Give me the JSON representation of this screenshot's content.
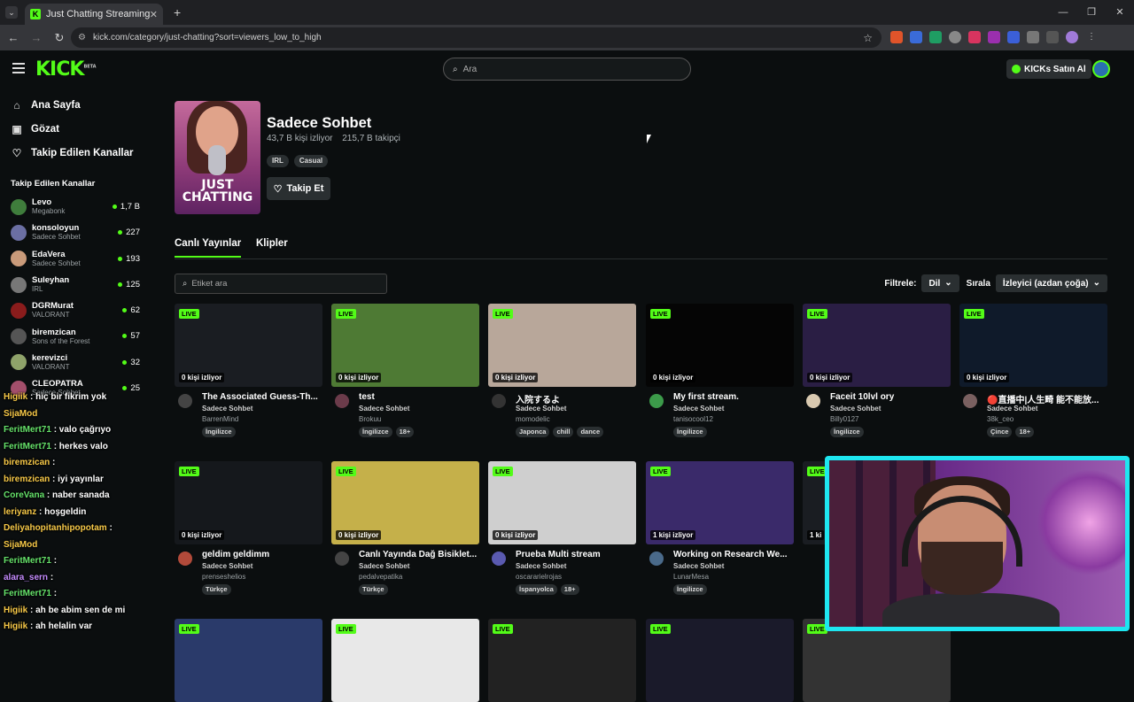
{
  "browser": {
    "tab_title": "Just Chatting Streaming - Live S",
    "url": "kick.com/category/just-chatting?sort=viewers_low_to_high"
  },
  "header": {
    "logo": "KICK",
    "logo_badge": "BETA",
    "search_placeholder": "Ara",
    "kicks_button": "KICKs Satın Al"
  },
  "sidebar": {
    "nav": [
      {
        "label": "Ana Sayfa",
        "icon": "home-icon"
      },
      {
        "label": "Gözat",
        "icon": "browse-icon"
      },
      {
        "label": "Takip Edilen Kanallar",
        "icon": "heart-icon"
      }
    ],
    "section_title": "Takip Edilen Kanallar",
    "channels": [
      {
        "name": "Levo",
        "category": "Megabonk",
        "viewers": "1,7 B",
        "color": "#3f7d3c"
      },
      {
        "name": "konsoloyun",
        "category": "Sadece Sohbet",
        "viewers": "227",
        "color": "#6b6fa3"
      },
      {
        "name": "EdaVera",
        "category": "Sadece Sohbet",
        "viewers": "193",
        "color": "#c99a7a"
      },
      {
        "name": "Suleyhan",
        "category": "IRL",
        "viewers": "125",
        "color": "#777"
      },
      {
        "name": "DGRMurat",
        "category": "VALORANT",
        "viewers": "62",
        "color": "#8a1c1c"
      },
      {
        "name": "biremzican",
        "category": "Sons of the Forest",
        "viewers": "57",
        "color": "#555"
      },
      {
        "name": "kerevizci",
        "category": "VALORANT",
        "viewers": "32",
        "color": "#8fa36a"
      },
      {
        "name": "CLEOPATRA",
        "category": "Sadece Sohbet",
        "viewers": "25",
        "color": "#a34f6b"
      }
    ]
  },
  "chat_overlay": [
    {
      "user": "Higiik",
      "msg": ": hiç bir fikrim yok",
      "cls": "u"
    },
    {
      "user": "SijaMod",
      "msg": "",
      "cls": "u"
    },
    {
      "user": "FeritMert71",
      "msg": ": valo çağrıyo",
      "cls": "g"
    },
    {
      "user": "FeritMert71",
      "msg": ": herkes valo",
      "cls": "g"
    },
    {
      "user": "biremzican",
      "msg": ":",
      "cls": "u"
    },
    {
      "user": "biremzican",
      "msg": ": iyi yayınlar",
      "cls": "u"
    },
    {
      "user": "CoreVana",
      "msg": ": naber sanada",
      "cls": "g"
    },
    {
      "user": "leriyanz",
      "msg": ": hoşgeldin",
      "cls": "u"
    },
    {
      "user": "Deliyahopitanhipopotam",
      "msg": ":",
      "cls": "u"
    },
    {
      "user": "SijaMod",
      "msg": "",
      "cls": "u"
    },
    {
      "user": "FeritMert71",
      "msg": ":",
      "cls": "g"
    },
    {
      "user": "alara_sern",
      "msg": ":",
      "cls": "p"
    },
    {
      "user": "FeritMert71",
      "msg": ":",
      "cls": "g"
    },
    {
      "user": "Higiik",
      "msg": ": ah be abim sen de mi",
      "cls": "u"
    },
    {
      "user": "Higiik",
      "msg": ": ah helalin var",
      "cls": "u"
    }
  ],
  "category": {
    "title": "Sadece Sohbet",
    "viewers": "43,7 B kişi izliyor",
    "followers": "215,7 B takipçi",
    "tags": [
      "IRL",
      "Casual"
    ],
    "follow_label": "Takip Et",
    "cover_text": "JUST CHATTING"
  },
  "tabs": [
    "Canlı Yayınlar",
    "Klipler"
  ],
  "tag_search_placeholder": "Etiket ara",
  "filters": {
    "filter_label": "Filtrele:",
    "language": "Dil",
    "sort_label": "Sırala",
    "sort_value": "İzleyici (azdan çoğa)"
  },
  "live_badge": "LIVE",
  "streams": [
    {
      "title": "The Associated Guess-Th...",
      "category": "Sadece Sohbet",
      "user": "BarrenMind",
      "viewers": "0 kişi izliyor",
      "tags": [
        "İngilizce"
      ],
      "thumb": "#1a1d22",
      "av": "#444"
    },
    {
      "title": "test",
      "category": "Sadece Sohbet",
      "user": "Brokuu",
      "viewers": "0 kişi izliyor",
      "tags": [
        "İngilizce",
        "18+"
      ],
      "thumb": "#4e7a34",
      "av": "#6b3b4a"
    },
    {
      "title": "入院するよ",
      "category": "Sadece Sohbet",
      "user": "momodelic",
      "viewers": "0 kişi izliyor",
      "tags": [
        "Japonca",
        "chill",
        "dance"
      ],
      "thumb": "#b8a79a",
      "av": "#333"
    },
    {
      "title": "My first stream.",
      "category": "Sadece Sohbet",
      "user": "tanisocool12",
      "viewers": "0 kişi izliyor",
      "tags": [
        "İngilizce"
      ],
      "thumb": "#050505",
      "av": "#3c9b4a"
    },
    {
      "title": "Faceit 10lvl ory",
      "category": "Sadece Sohbet",
      "user": "Billy0127",
      "viewers": "0 kişi izliyor",
      "tags": [
        "İngilizce"
      ],
      "thumb": "#2a1e44",
      "av": "#d9c9b0"
    },
    {
      "title": "🔴直播中|人生畸 能不能放...",
      "category": "Sadece Sohbet",
      "user": "38k_ceo",
      "viewers": "0 kişi izliyor",
      "tags": [
        "Çince",
        "18+"
      ],
      "thumb": "#0f1a2a",
      "av": "#7a6060"
    },
    {
      "title": "geldim geldimm",
      "category": "Sadece Sohbet",
      "user": "prenseshelios",
      "viewers": "0 kişi izliyor",
      "tags": [
        "Türkçe"
      ],
      "thumb": "#15181c",
      "av": "#b24a3a"
    },
    {
      "title": "Canlı Yayında Dağ Bisiklet...",
      "category": "Sadece Sohbet",
      "user": "pedalvepatika",
      "viewers": "0 kişi izliyor",
      "tags": [
        "Türkçe"
      ],
      "thumb": "#c5b04a",
      "av": "#444"
    },
    {
      "title": "Prueba Multi stream",
      "category": "Sadece Sohbet",
      "user": "oscararielrojas",
      "viewers": "0 kişi izliyor",
      "tags": [
        "İspanyolca",
        "18+"
      ],
      "thumb": "#cfcfcf",
      "av": "#5a5ab0"
    },
    {
      "title": "Working on Research We...",
      "category": "Sadece Sohbet",
      "user": "LunarMesa",
      "viewers": "1 kişi izliyor",
      "tags": [
        "İngilizce"
      ],
      "thumb": "#3a2a6a",
      "av": "#4a6a8a"
    }
  ],
  "partial_card_viewers": "1 ki"
}
